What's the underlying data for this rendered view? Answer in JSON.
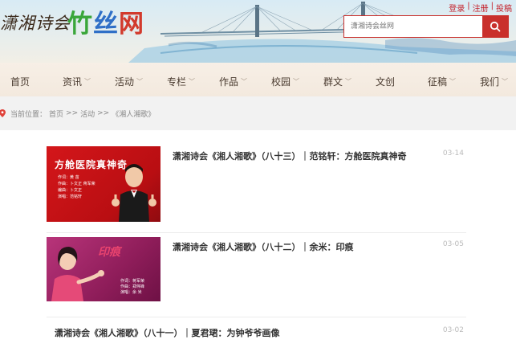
{
  "header": {
    "logo_left": "潇湘诗会",
    "logo_right_parts": [
      "竹",
      "丝",
      "网"
    ],
    "top_links": [
      "登录",
      "注册",
      "投稿"
    ],
    "search_placeholder": "潇湘诗会丝网"
  },
  "nav": {
    "items": [
      {
        "label": "首页",
        "has_dropdown": false
      },
      {
        "label": "资讯",
        "has_dropdown": true
      },
      {
        "label": "活动",
        "has_dropdown": true
      },
      {
        "label": "专栏",
        "has_dropdown": true
      },
      {
        "label": "作品",
        "has_dropdown": true
      },
      {
        "label": "校园",
        "has_dropdown": true
      },
      {
        "label": "群文",
        "has_dropdown": true
      },
      {
        "label": "文创",
        "has_dropdown": false
      },
      {
        "label": "征稿",
        "has_dropdown": true
      },
      {
        "label": "我们",
        "has_dropdown": true
      }
    ]
  },
  "breadcrumb": {
    "prefix": "当前位置：",
    "items": [
      "首页",
      "活动",
      "《湘人湘歌》"
    ],
    "separator": ">>"
  },
  "articles": [
    {
      "title": "潇湘诗会《湘人湘歌》（八十三）｜范铭轩：方舱医院真神奇",
      "date": "03-14",
      "thumb_headline": "方舱医院真神奇",
      "thumb_credits": [
        "作词：黄  苗",
        "作曲：卜文正  蒋军荣",
        "编曲：卜文正",
        "演唱：范铭轩"
      ]
    },
    {
      "title": "潇湘诗会《湘人湘歌》（八十二）｜余米：印痕",
      "date": "03-05",
      "thumb_headline": "印痕",
      "thumb_credits": [
        "作词：蒋军荣",
        "作曲：郑伟锋",
        "演唱：余  米"
      ]
    },
    {
      "title": "潇湘诗会《湘人湘歌》（八十一）｜夏君珺：为钟爷爷画像",
      "date": "03-02"
    }
  ],
  "colors": {
    "accent_red": "#c9302c",
    "nav_bg": "#f3e9de",
    "crumb_bg": "#f2f2f2"
  }
}
